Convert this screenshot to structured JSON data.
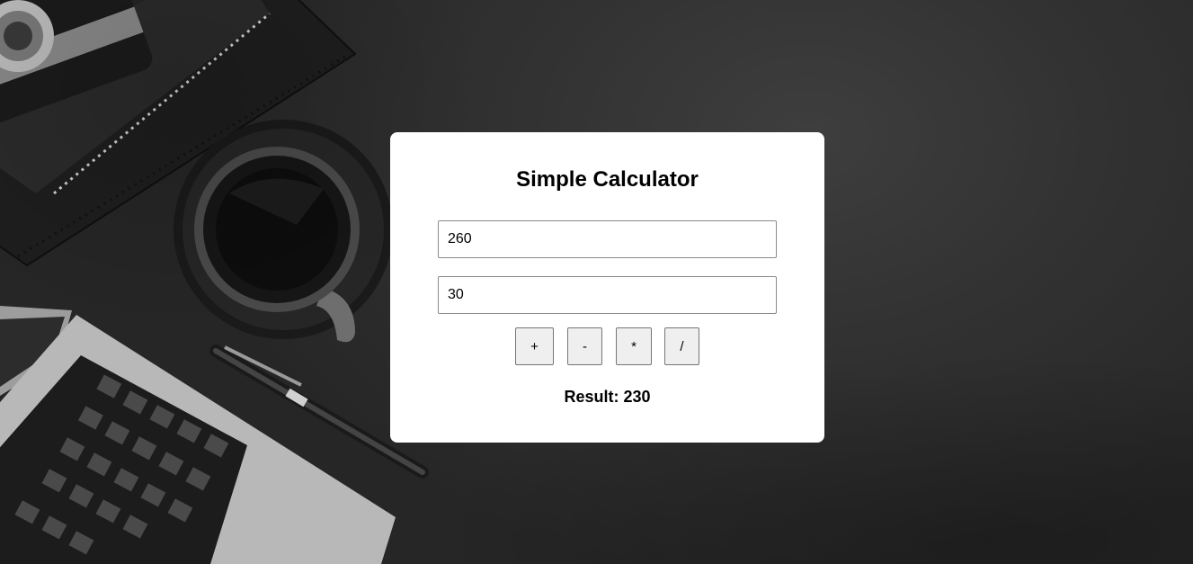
{
  "calculator": {
    "title": "Simple Calculator",
    "first_number": "260",
    "second_number": "30",
    "operations": {
      "add": "+",
      "subtract": "-",
      "multiply": "*",
      "divide": "/"
    },
    "result_label": "Result:",
    "result_value": "230"
  },
  "background": {
    "description_items": [
      "camera-icon",
      "notebook-icon",
      "coffee-cup-icon",
      "laptop-icon",
      "pen-icon"
    ]
  },
  "colors": {
    "card_background": "#ffffff",
    "page_background": "#2e2e2e",
    "button_background": "#efefef"
  }
}
